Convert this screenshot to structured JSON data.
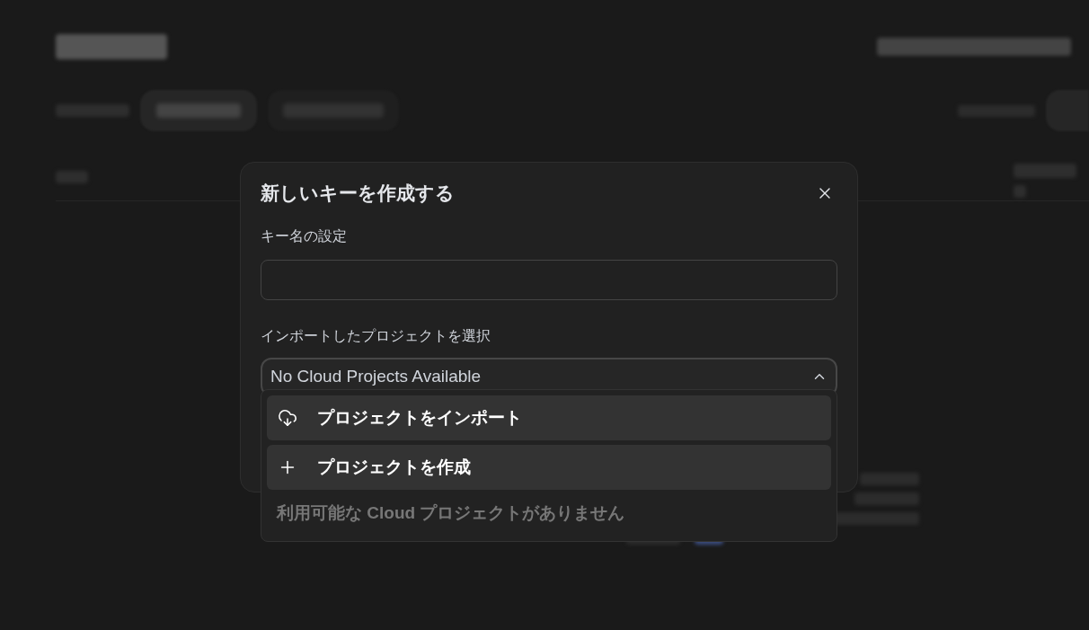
{
  "dialog": {
    "title": "新しいキーを作成する",
    "name_label": "キー名の設定",
    "project_label": "インポートしたプロジェクトを選択",
    "project_select": {
      "value": "No Cloud Projects Available",
      "expanded": true
    },
    "menu_items": [
      {
        "kind": "import",
        "label": "プロジェクトをインポート"
      },
      {
        "kind": "create",
        "label": "プロジェクトを作成"
      }
    ],
    "empty_note": "利用可能な Cloud プロジェクトがありません"
  }
}
